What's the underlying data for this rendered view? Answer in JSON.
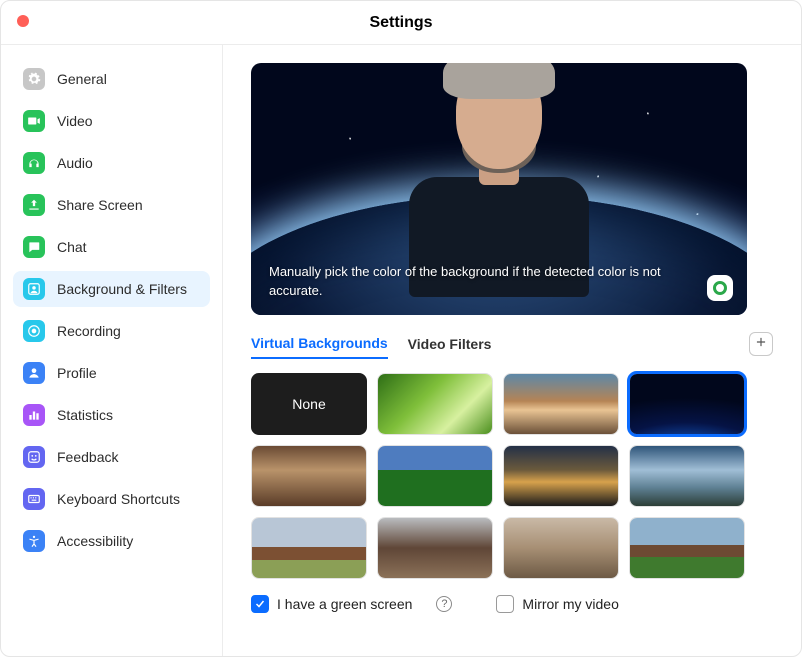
{
  "window": {
    "title": "Settings"
  },
  "traffic": {
    "close_color": "#ff5f57"
  },
  "sidebar": {
    "items": [
      {
        "label": "General",
        "icon": "gear",
        "color": "#c7c7c7"
      },
      {
        "label": "Video",
        "icon": "video",
        "color": "#28c35a"
      },
      {
        "label": "Audio",
        "icon": "headphones",
        "color": "#28c35a"
      },
      {
        "label": "Share Screen",
        "icon": "share",
        "color": "#28c35a"
      },
      {
        "label": "Chat",
        "icon": "chat",
        "color": "#28c35a"
      },
      {
        "label": "Background & Filters",
        "icon": "person",
        "color": "#28c8eb",
        "active": true
      },
      {
        "label": "Recording",
        "icon": "record",
        "color": "#28c8eb"
      },
      {
        "label": "Profile",
        "icon": "profile",
        "color": "#3b82f6"
      },
      {
        "label": "Statistics",
        "icon": "stats",
        "color": "#a855f7"
      },
      {
        "label": "Feedback",
        "icon": "smile",
        "color": "#6366f1"
      },
      {
        "label": "Keyboard Shortcuts",
        "icon": "keyboard",
        "color": "#6366f1"
      },
      {
        "label": "Accessibility",
        "icon": "accessibility",
        "color": "#3b82f6"
      }
    ]
  },
  "preview": {
    "caption": "Manually pick the color of the background if the detected color is not accurate.",
    "picker_color": "#2ba84a"
  },
  "tabs": {
    "items": [
      {
        "label": "Virtual Backgrounds",
        "active": true
      },
      {
        "label": "Video Filters",
        "active": false
      }
    ],
    "add_label": "+"
  },
  "backgrounds": {
    "none_label": "None",
    "items": [
      {
        "name": "none"
      },
      {
        "name": "grass"
      },
      {
        "name": "golden-gate-bridge"
      },
      {
        "name": "earth-from-space",
        "selected": true
      },
      {
        "name": "bar-interior"
      },
      {
        "name": "rainbow-field"
      },
      {
        "name": "sunset-clouds"
      },
      {
        "name": "lake-reflection"
      },
      {
        "name": "campus-tower"
      },
      {
        "name": "cafe-patio"
      },
      {
        "name": "street-buildings"
      },
      {
        "name": "campus-lawn"
      }
    ]
  },
  "options": {
    "green_screen_label": "I have a green screen",
    "green_screen_checked": true,
    "mirror_label": "Mirror my video",
    "mirror_checked": false
  },
  "accent": "#0b6cff"
}
